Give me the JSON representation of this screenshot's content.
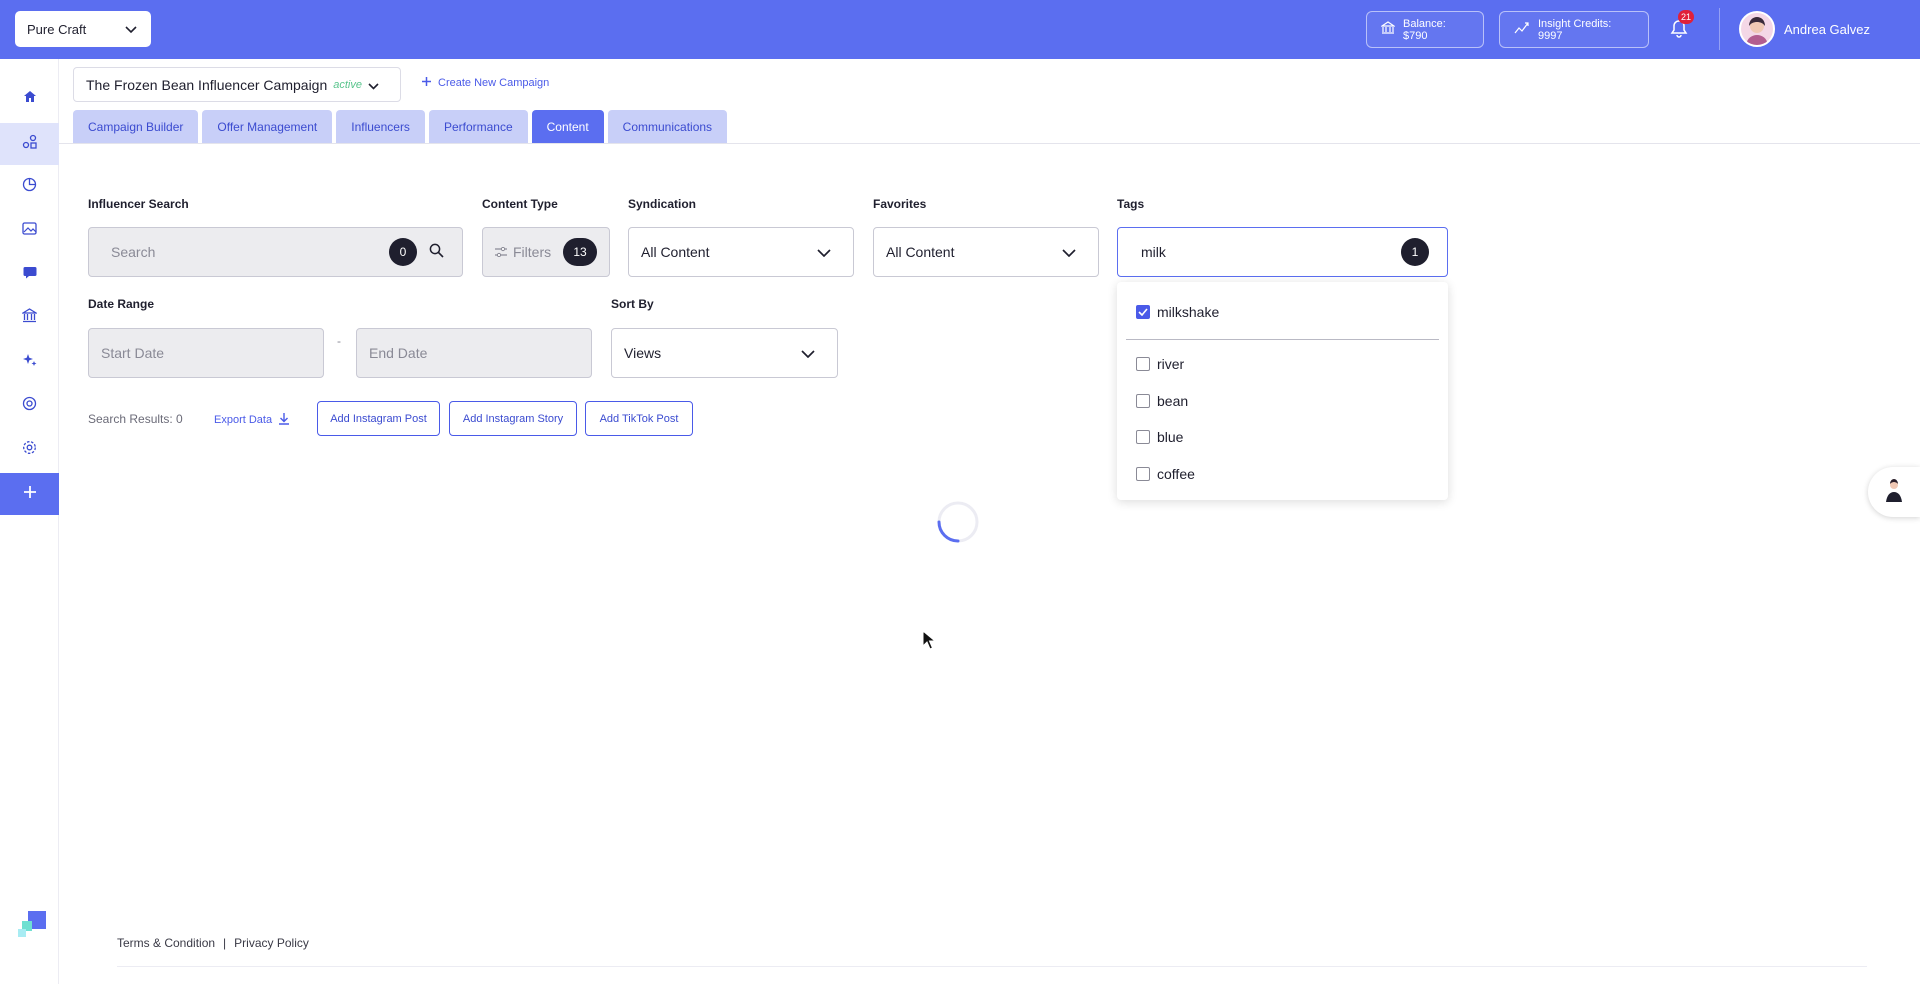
{
  "topbar": {
    "brand": "Pure Craft",
    "balance": "Balance: $790",
    "insight_credits": "Insight Credits: 9997",
    "notifications": "21",
    "user_name": "Andrea Galvez"
  },
  "campaign": {
    "name": "The Frozen Bean Influencer Campaign",
    "status": "active",
    "create_label": "Create New Campaign"
  },
  "tabs": [
    {
      "label": "Campaign Builder"
    },
    {
      "label": "Offer Management"
    },
    {
      "label": "Influencers"
    },
    {
      "label": "Performance"
    },
    {
      "label": "Content"
    },
    {
      "label": "Communications"
    }
  ],
  "filters": {
    "influencer_search": {
      "label": "Influencer Search",
      "placeholder": "Search",
      "count": "0"
    },
    "content_type": {
      "label": "Content Type",
      "placeholder": "Filters",
      "count": "13"
    },
    "syndication": {
      "label": "Syndication",
      "value": "All Content"
    },
    "favorites": {
      "label": "Favorites",
      "value": "All Content"
    },
    "tags": {
      "label": "Tags",
      "value": "milk",
      "count": "1"
    },
    "date_range": {
      "label": "Date Range",
      "start_placeholder": "Start Date",
      "end_placeholder": "End Date",
      "separator": "-"
    },
    "sort_by": {
      "label": "Sort By",
      "value": "Views"
    }
  },
  "tag_options": [
    {
      "label": "milkshake",
      "checked": true
    },
    {
      "label": "river",
      "checked": false
    },
    {
      "label": "bean",
      "checked": false
    },
    {
      "label": "blue",
      "checked": false
    },
    {
      "label": "coffee",
      "checked": false
    }
  ],
  "results": {
    "text": "Search Results: 0",
    "export_label": "Export Data",
    "buttons": [
      "Add Instagram Post",
      "Add Instagram Story",
      "Add TikTok Post"
    ]
  },
  "footer": {
    "terms": "Terms & Condition",
    "separator": "|",
    "privacy": "Privacy Policy"
  },
  "colors": {
    "primary": "#5b6ef0",
    "tab_inactive": "#c8cff8",
    "status_active": "#58c48c",
    "badge": "#e0203a"
  }
}
